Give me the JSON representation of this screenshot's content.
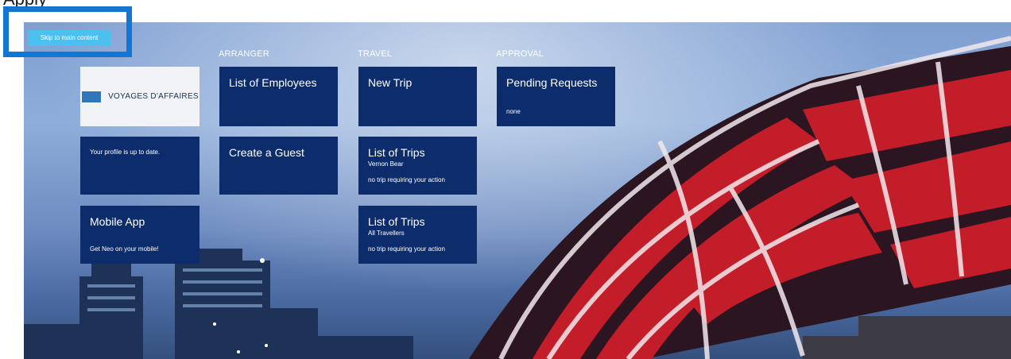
{
  "top_hint": "Apply",
  "skip_link": "Skip to main content",
  "logo": {
    "text": "VOYAGES D'AFFAIRES"
  },
  "columns": {
    "arranger": "ARRANGER",
    "travel": "TRAVEL",
    "approval": "APPROVAL"
  },
  "tiles": {
    "profile": {
      "text": "Your profile is up to date."
    },
    "mobile_app": {
      "title": "Mobile App",
      "footer": "Get Neo on your mobile!"
    },
    "list_of_employees": {
      "title": "List of Employees"
    },
    "create_guest": {
      "title": "Create a Guest"
    },
    "new_trip": {
      "title": "New Trip"
    },
    "trips_user": {
      "title": "List of Trips",
      "subtitle": "Vernon Bear",
      "footer": "no trip requiring your action"
    },
    "trips_all": {
      "title": "List of Trips",
      "subtitle": "All Travellers",
      "footer": "no trip requiring your action"
    },
    "pending_requests": {
      "title": "Pending Requests",
      "footer": "none"
    }
  },
  "colors": {
    "tile_bg": "#0d2c6b",
    "skip_link_bg": "#4cc1f0",
    "focus_ring": "#1376d3",
    "bridge_red": "#c41d2a"
  }
}
